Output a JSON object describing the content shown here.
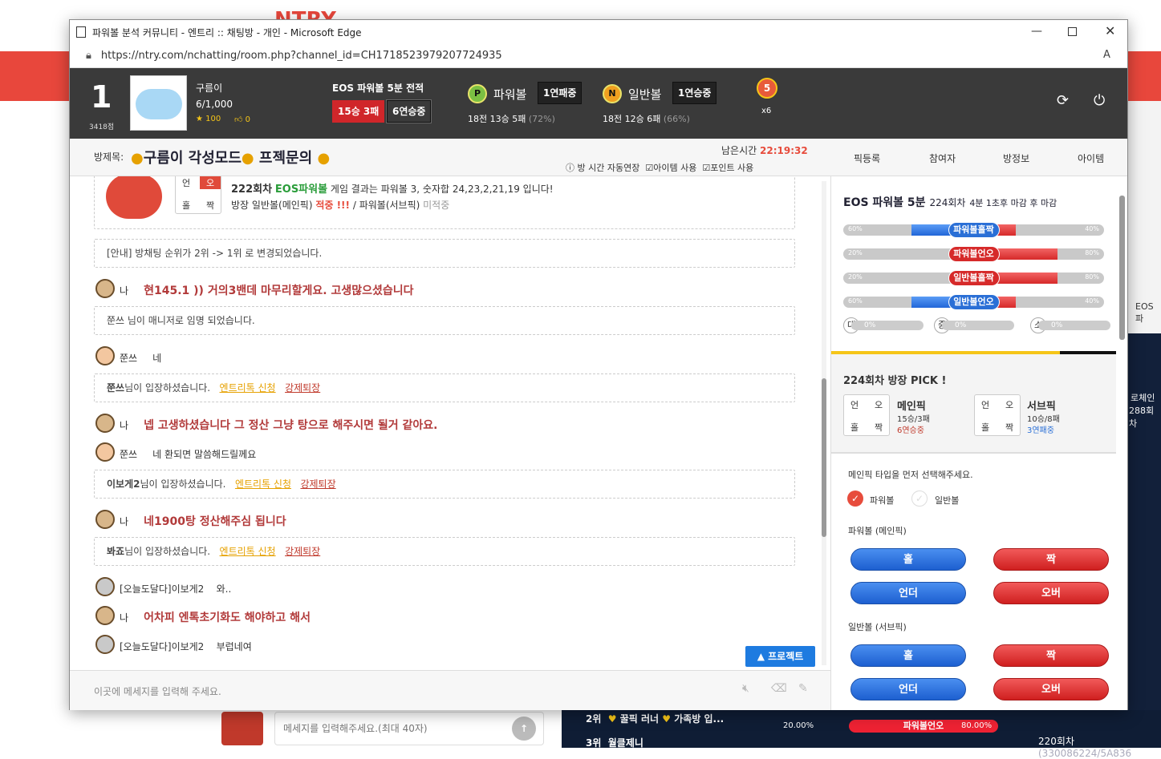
{
  "window": {
    "title": "파워볼 분석 커뮤니티 - 엔트리 :: 채팅방 - 개인 - Microsoft Edge",
    "url": "https://ntry.com/nchatting/room.php?channel_id=CH1718523979207724935"
  },
  "bg": {
    "logo": "NTRY",
    "right_text": "EOS파",
    "right_count": "288회차",
    "right_label": "로체인",
    "bottom_input_placeholder": "메세지를 입력해주세요.(최대 40자)",
    "rank2": "2위",
    "rank2_name": "꿀픽 러너",
    "rank2_extra": "가족방 입...",
    "rank3": "3위",
    "rank3_name": "월클제니",
    "percent_left": "20.00%",
    "percent_right": "80.00%",
    "round220": "220회차",
    "hash220": "(330086224/5A836",
    "odd_label": "파워볼언오"
  },
  "profile": {
    "rank": "1",
    "score": "3418점",
    "name": "구름이",
    "members": "6/1,000",
    "stars": "100",
    "likes": "0"
  },
  "eos": {
    "title": "EOS 파워볼 5분 전적",
    "record": "15승 3패",
    "streak": "6연승중"
  },
  "pb": {
    "badge": "P",
    "label": "파워볼",
    "streak": "1연패중",
    "stats": "18전 13승 5패",
    "pct": "(72%)"
  },
  "nb": {
    "badge": "N",
    "label": "일반볼",
    "streak": "1연승중",
    "stats": "18전 12승 6패",
    "pct": "(66%)"
  },
  "medal": {
    "num": "5",
    "mult": "x6"
  },
  "room": {
    "prefix": "방제목:",
    "title": "구름이 각성모드",
    "title2": "프젝문의",
    "timer_label": "남은시간",
    "timer": "22:19:32",
    "opt1": "방 시간 자동연장",
    "opt2": "아이템 사용",
    "opt3": "포인트 사용"
  },
  "tabs": [
    "픽등록",
    "참여자",
    "방정보",
    "아이템"
  ],
  "chat": {
    "result_round": "222회차",
    "result_game": "EOS파워볼",
    "result_text": "게임 결과는 파워볼 3, 숫자합 24,23,2,21,19 입니다!",
    "result_line2a": "방장 일반볼(메인픽)",
    "result_hit": "적중 !!!",
    "result_line2b": "/ 파워볼(서브픽)",
    "result_miss": "미적중",
    "ox": [
      "언",
      "오",
      "홀",
      "짝"
    ],
    "notice1": "[안내] 방채팅 순위가 2위 -> 1위 로 변경되었습니다.",
    "me": "나",
    "m1": "현145.1 )) 거의3밴데 마무리할게요. 고생많으셨습니다",
    "notice2": "쭌쓰 님이 매니저로 임명 되었습니다.",
    "u1": "쭌쓰",
    "u1msg": "네",
    "enter1_name": "쭌쓰",
    "enter_text": "님이 입장하셨습니다.",
    "link1": "엔트리톡 신청",
    "link2": "강제퇴장",
    "m2": "넵 고생하셨습니다 그 정산 그냥 탕으로 해주시면 될거 같아요.",
    "u2msg": "네 환되면 말씀해드릴께요",
    "enter2_name": "이보게2",
    "m3": "네1900탕 정산해주심 됩니다",
    "enter3_name": "봐죠",
    "u3": "[오늘도달다]이보게2",
    "u3msg": "와..",
    "m4": "어차피 엔톡초기화도 해야하고 해서",
    "u4msg": "부럽네여",
    "project_btn": "▲ 프로젝트",
    "input_placeholder": "이곳에 메세지를 입력해 주세요."
  },
  "side": {
    "title": "EOS 파워볼 5분",
    "round": "224회차",
    "remain": "4분 1초후 마감 후 마감",
    "bars": [
      {
        "label": "파워볼홀짝",
        "left": "60%",
        "right": "40%",
        "blue": 0.6
      },
      {
        "label": "파워볼언오",
        "left": "20%",
        "right": "80%",
        "blue": 0.2
      },
      {
        "label": "일반볼홀짝",
        "left": "20%",
        "right": "80%",
        "blue": 0.2
      },
      {
        "label": "일반볼언오",
        "left": "60%",
        "right": "40%",
        "blue": 0.6
      }
    ],
    "size": [
      {
        "k": "대",
        "v": "0%"
      },
      {
        "k": "중",
        "v": "0%"
      },
      {
        "k": "소",
        "v": "0%"
      }
    ],
    "pick_title": "224회차 방장 PICK !",
    "main_label": "메인픽",
    "main_rec": "15승/3패",
    "main_streak": "6연승중",
    "sub_label": "서브픽",
    "sub_rec": "10승/8패",
    "sub_streak": "3연패중",
    "select_hint": "메인픽 타입을 먼저 선택해주세요.",
    "radio1": "파워볼",
    "radio2": "일반볼",
    "pb_main": "파워볼 (메인픽)",
    "nb_sub": "일반볼 (서브픽)",
    "btn_odd": "홀",
    "btn_even": "짝",
    "btn_under": "언더",
    "btn_over": "오버"
  },
  "colors": {
    "header": "#3a3a3a",
    "accent_red": "#e8473c",
    "win_red": "#c0392b",
    "loss_blue": "#2a6fd6",
    "timer": "#e74c3c"
  }
}
